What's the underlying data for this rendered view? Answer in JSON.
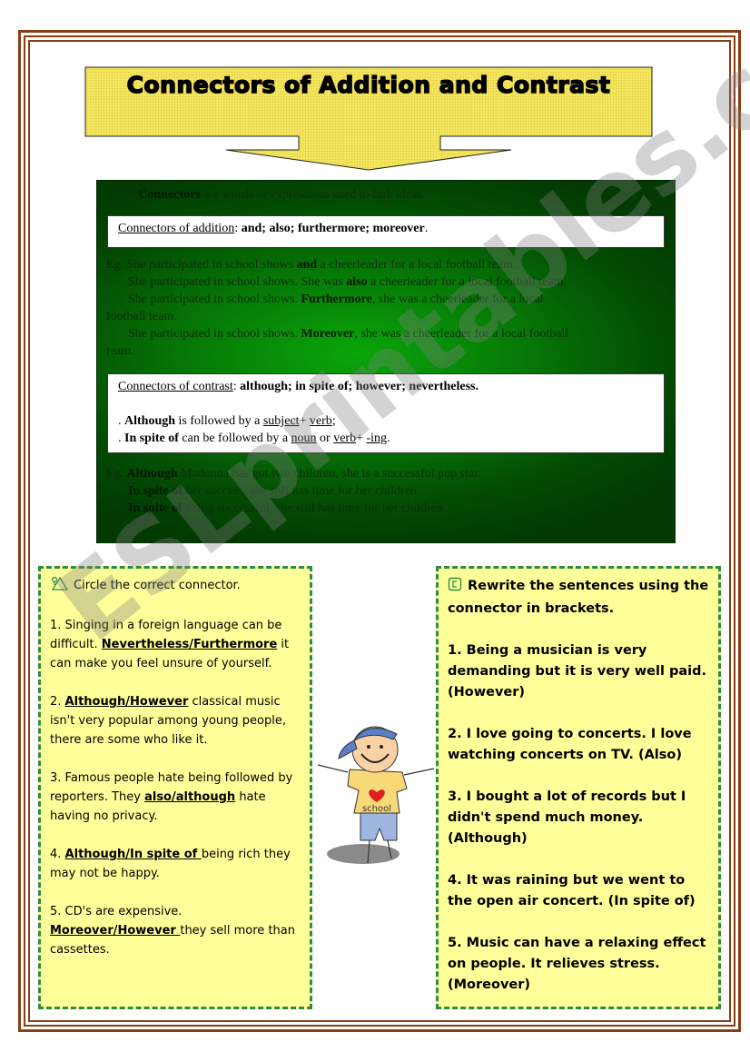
{
  "title": "Connectors of Addition and Contrast",
  "definition": {
    "prefix": ">",
    "term": "Connectors",
    "rest": " are words or expressions used to link ideas."
  },
  "addition": {
    "label": "Connectors of addition",
    "list": "and; also; furthermore; moreover",
    "examples": [
      {
        "pre": "Eg. She participated in school shows ",
        "bold": "and",
        "post": " a cheerleader for a local football team."
      },
      {
        "pre": "She participated in school shows. She was ",
        "bold": "also",
        "post": " a cheerleader for a local football team."
      },
      {
        "pre": "She participated in school shows. ",
        "bold": "Furthermore",
        "post": ", she was a cheerleader for a local",
        "wrap": "football team."
      },
      {
        "pre": "She participated in school shows. ",
        "bold": "Moreover",
        "post": ", she was a cheerleader for a local football",
        "wrap": "team."
      }
    ]
  },
  "contrast": {
    "label": "Connectors of contrast",
    "list": "although; in spite of; however; nevertheless.",
    "rule1": {
      "bold": "Although",
      "text": " is followed by a ",
      "u1": "subject",
      "plus": "+ ",
      "u2": "verb",
      "end": ";"
    },
    "rule2": {
      "bold": "In spite of",
      "text": " can be followed by a ",
      "u1": "noun",
      "or": " or ",
      "u2": "verb",
      "plus": "+ ",
      "u3": "-ing",
      "end": "."
    },
    "examples": [
      {
        "pre": "Eg. ",
        "bold": "Although",
        "post": " Madonna has got two children, she is a successful pop star."
      },
      {
        "pre": "",
        "bold": "In spite of",
        "post": " her success, she still has time for her children."
      },
      {
        "pre": "",
        "bold": "In spite of",
        "post": " being successful, she still has time for her children."
      }
    ]
  },
  "exercise1": {
    "instruction": "Circle the correct connector.",
    "items": [
      {
        "pre": "1. Singing in a foreign language can be difficult. ",
        "choice": "Nevertheless/Furthermore",
        "post": " it can make you feel unsure of yourself."
      },
      {
        "pre": "2. ",
        "choice": "Although/However",
        "post": " classical music isn't very popular among young people, there are some who like it."
      },
      {
        "pre": "3. Famous people hate being followed by reporters. They ",
        "choice": "also/although",
        "post": " hate having no privacy."
      },
      {
        "pre": "4. ",
        "choice": "Although/In spite of ",
        "post": "being rich they may not be happy."
      },
      {
        "pre": "5. CD's are expensive. ",
        "choice": "Moreover/However ",
        "post": "they sell more than cassettes."
      }
    ]
  },
  "exercise2": {
    "instruction": "Rewrite the sentences using the connector in brackets.",
    "items": [
      "1. Being a musician is very demanding but it is very well paid. (However)",
      "2. I love going to concerts. I love watching concerts on TV. (Also)",
      "3. I bought a lot of records but I didn't spend much money. (Although)",
      "4. It was raining but we went to the open air concert. (In spite of)",
      "5. Music can have a relaxing effect on people. It relieves stress. (Moreover)"
    ]
  },
  "cartoon": {
    "shirt_text": "school"
  },
  "watermark": "ESLprintables.com",
  "colors": {
    "border": "#8a3c14",
    "title_fill": "#f0e05a",
    "panel_green": "#067a06",
    "exercise_bg": "#ffff99",
    "dash": "#2e8b47",
    "heart": "#e02020"
  }
}
